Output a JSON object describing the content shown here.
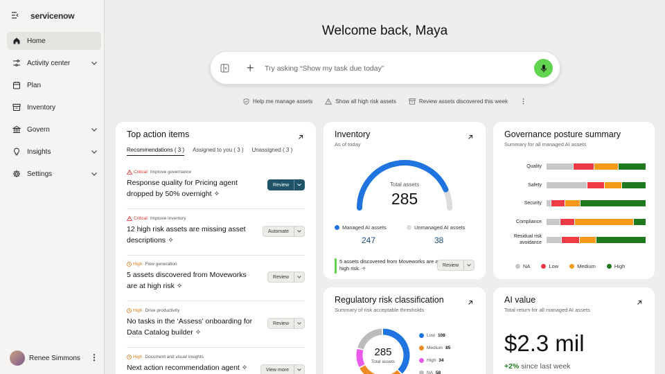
{
  "brand": {
    "logo": "servicenow"
  },
  "sidebar": {
    "items": [
      {
        "label": "Home",
        "icon": "home-icon",
        "active": true,
        "chevron": false
      },
      {
        "label": "Activity center",
        "icon": "activity-icon",
        "active": false,
        "chevron": true
      },
      {
        "label": "Plan",
        "icon": "calendar-icon",
        "active": false,
        "chevron": false
      },
      {
        "label": "Inventory",
        "icon": "archive-icon",
        "active": false,
        "chevron": false
      },
      {
        "label": "Govern",
        "icon": "bank-icon",
        "active": false,
        "chevron": true
      },
      {
        "label": "Insights",
        "icon": "lightbulb-icon",
        "active": false,
        "chevron": true
      },
      {
        "label": "Settings",
        "icon": "gear-icon",
        "active": false,
        "chevron": true
      }
    ],
    "user": {
      "name": "Renee Simmons"
    }
  },
  "header": {
    "welcome": "Welcome back, Maya"
  },
  "search": {
    "placeholder": "Try asking  “Show my task due today”"
  },
  "suggestions": [
    "Help me manage assets",
    "Show all high risk assets",
    "Review assets discovered this week"
  ],
  "actions": {
    "title": "Top action items",
    "tabs": [
      "Recommendations ( 3 )",
      "Assigned to you ( 3 )",
      "Unassigned  ( 3 )"
    ],
    "items": [
      {
        "level": "Critical",
        "category": "Improve governance",
        "text": "Response quality for Pricing agent dropped by 50% overnight",
        "button": "Review",
        "primary": true
      },
      {
        "level": "Critical",
        "category": "Improve inventory",
        "text": "12 high risk assets are missing asset descriptions",
        "button": "Automate",
        "primary": false
      },
      {
        "level": "High",
        "category": "Flow generation",
        "text": "5 assets discovered from Moveworks are at high risk",
        "button": "Review",
        "primary": false
      },
      {
        "level": "High",
        "category": "Drive productivity",
        "text": "No tasks in the ‘Assess’ onboarding for Data Catalog builder",
        "button": "Review",
        "primary": false
      },
      {
        "level": "High",
        "category": "Document and visual insights",
        "text": "Next action recommendation agent",
        "button": "View more",
        "primary": false
      }
    ]
  },
  "inventory": {
    "title": "Inventory",
    "subtitle": "As of today",
    "gauge_label": "Total assets",
    "total": "285",
    "managed_label": "Managed AI assets",
    "managed": "247",
    "unmanaged_label": "Unmanaged AI assets",
    "unmanaged": "38",
    "managed_fraction": 0.867,
    "note": "5 assets discovered from Moveworks are at high risk.",
    "note_button": "Review",
    "colors": {
      "managed": "#1f74e0",
      "unmanaged": "#dcdcdc"
    }
  },
  "governance": {
    "title": "Governance posture summary",
    "subtitle": "Summary for all managed AI assets",
    "legend": [
      {
        "label": "NA",
        "color": "#c8c8c8"
      },
      {
        "label": "Low",
        "color": "#ef3b45"
      },
      {
        "label": "Medium",
        "color": "#f59a1b"
      },
      {
        "label": "High",
        "color": "#1f7a1f"
      }
    ],
    "rows": [
      {
        "label": "Quality",
        "values": [
          27,
          21,
          24,
          28
        ]
      },
      {
        "label": "Safety",
        "values": [
          42,
          18,
          17,
          25
        ]
      },
      {
        "label": "Security",
        "values": [
          4,
          14,
          15,
          67
        ]
      },
      {
        "label": "Compliance",
        "values": [
          13,
          14,
          58,
          12
        ]
      },
      {
        "label": "Residual risk avoidance",
        "values": [
          15,
          18,
          16,
          51
        ]
      }
    ]
  },
  "regulatory": {
    "title": "Regulatory risk classification",
    "subtitle": "Summary of risk acceptable thresholds",
    "total": "285",
    "total_label": "Total assets",
    "legend": [
      {
        "label": "Low",
        "value": "108",
        "color": "#1f74e0"
      },
      {
        "label": "Medium",
        "value": "85",
        "color": "#f08a24"
      },
      {
        "label": "High",
        "value": "34",
        "color": "#e85ae8"
      },
      {
        "label": "NA",
        "value": "58",
        "color": "#bcbcbc"
      }
    ]
  },
  "ai_value": {
    "title": "AI value",
    "subtitle": "Total return for all managed AI assets",
    "value": "$2.3 mil",
    "delta": "+2%",
    "delta_text": " since last week"
  }
}
